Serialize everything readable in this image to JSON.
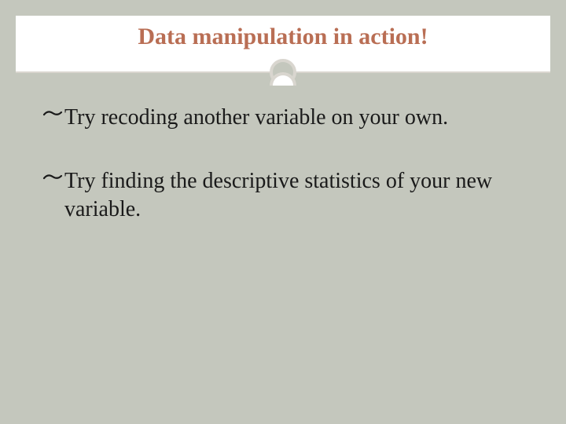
{
  "slide": {
    "title": "Data manipulation in action!",
    "bullets": [
      {
        "glyph": "d",
        "text": "Try recoding another variable on your own."
      },
      {
        "glyph": "d",
        "text": "Try finding the descriptive statistics of your new variable."
      }
    ]
  }
}
